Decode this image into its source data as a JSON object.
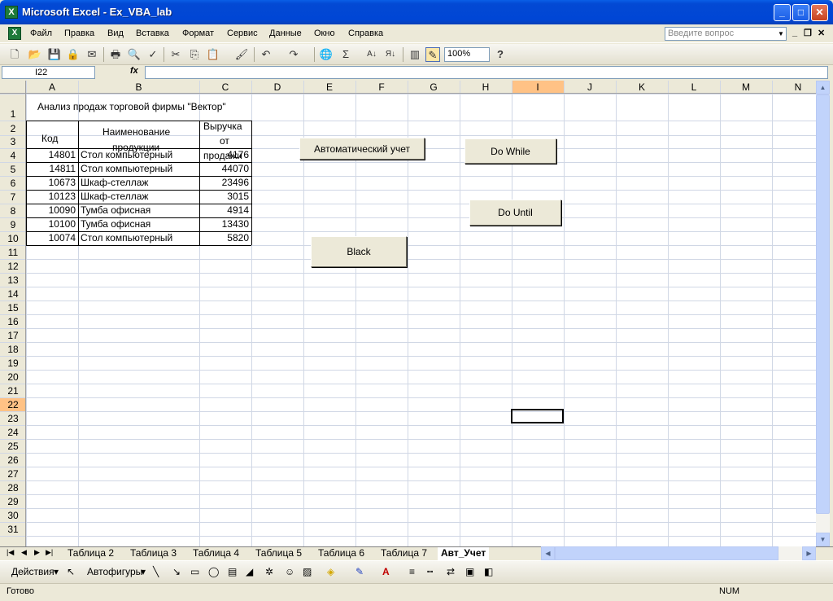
{
  "window": {
    "title": "Microsoft Excel - Ex_VBA_lab",
    "app_icon": "X",
    "buttons": {
      "minimize": "_",
      "maximize": "□",
      "close": "✕"
    }
  },
  "menubar": {
    "items": [
      "Файл",
      "Правка",
      "Вид",
      "Вставка",
      "Формат",
      "Сервис",
      "Данные",
      "Окно",
      "Справка"
    ],
    "help_placeholder": "Введите вопрос",
    "doc_controls": {
      "minimize": "_",
      "restore": "❐",
      "close": "✕"
    }
  },
  "toolbar": {
    "icons": [
      "new-icon",
      "open-icon",
      "save-icon",
      "permission-icon",
      "mail-icon",
      "print-icon",
      "print-preview-icon",
      "spelling-icon",
      "cut-icon",
      "copy-icon",
      "paste-icon",
      "format-painter-icon",
      "undo-icon",
      "redo-icon",
      "hyperlink-icon",
      "autosum-icon",
      "sort-asc-icon",
      "sort-desc-icon",
      "chart-wizard-icon",
      "drawing-icon",
      "help-icon"
    ],
    "icon_glyphs": [
      "🗋",
      "📂",
      "💾",
      "🔒",
      "✉",
      "🖶",
      "🔍",
      "✓",
      "✂",
      "⎘",
      "📋",
      "🖌",
      "↶",
      "↷",
      "🌐",
      "Σ",
      "A↓",
      "Я↓",
      "▥",
      "✎",
      "?"
    ],
    "zoom": "100%"
  },
  "formula_bar": {
    "name_box": "I22",
    "fx_label": "fx",
    "formula": ""
  },
  "grid": {
    "columns": [
      "A",
      "B",
      "C",
      "D",
      "E",
      "F",
      "G",
      "H",
      "I",
      "J",
      "K",
      "L",
      "M",
      "N"
    ],
    "active_column": "I",
    "rows": [
      "1",
      "2",
      "3",
      "4",
      "5",
      "6",
      "7",
      "8",
      "9",
      "10",
      "11",
      "12",
      "13",
      "14",
      "15",
      "16",
      "17",
      "18",
      "19",
      "20",
      "21",
      "22",
      "23",
      "24",
      "25",
      "26",
      "27",
      "28",
      "29",
      "30",
      "31"
    ],
    "active_row": "22",
    "title": "Анализ продаж торговой фирмы \"Вектор\"",
    "headers": {
      "code": "Код",
      "name_line1": "Наименование",
      "name_line2": "продукции",
      "revenue_line1": "Выручка",
      "revenue_line2": "от",
      "revenue_line3": "продажи"
    },
    "table": [
      {
        "code": "14801",
        "name": "Стол компьютерный",
        "revenue": "4176"
      },
      {
        "code": "14811",
        "name": "Стол компьютерный",
        "revenue": "44070"
      },
      {
        "code": "10673",
        "name": "Шкаф-стеллаж",
        "revenue": "23496"
      },
      {
        "code": "10123",
        "name": "Шкаф-стеллаж",
        "revenue": "3015"
      },
      {
        "code": "10090",
        "name": "Тумба офисная",
        "revenue": "4914"
      },
      {
        "code": "10100",
        "name": "Тумба офисная",
        "revenue": "13430"
      },
      {
        "code": "10074",
        "name": "Стол компьютерный",
        "revenue": "5820"
      }
    ]
  },
  "buttons": {
    "auto_account": "Автоматический учет",
    "do_while": "Do While",
    "do_until": "Do Until",
    "black": "Black"
  },
  "sheet_tabs": {
    "nav": [
      "|◀",
      "◀",
      "▶",
      "▶|"
    ],
    "tabs": [
      "Таблица 2",
      "Таблица 3",
      "Таблица 4",
      "Таблица 5",
      "Таблица 6",
      "Таблица 7",
      "Авт_Учет"
    ],
    "active": "Авт_Учет"
  },
  "drawing_bar": {
    "actions": "Действия",
    "autoshapes": "Автофигуры"
  },
  "status_bar": {
    "ready": "Готово",
    "num": "NUM"
  },
  "colors": {
    "title_bar": "#0046d5",
    "header_bg": "#ece9d8",
    "active_header": "#ffc285",
    "gridline": "#d0d7e5",
    "border": "#000000"
  }
}
